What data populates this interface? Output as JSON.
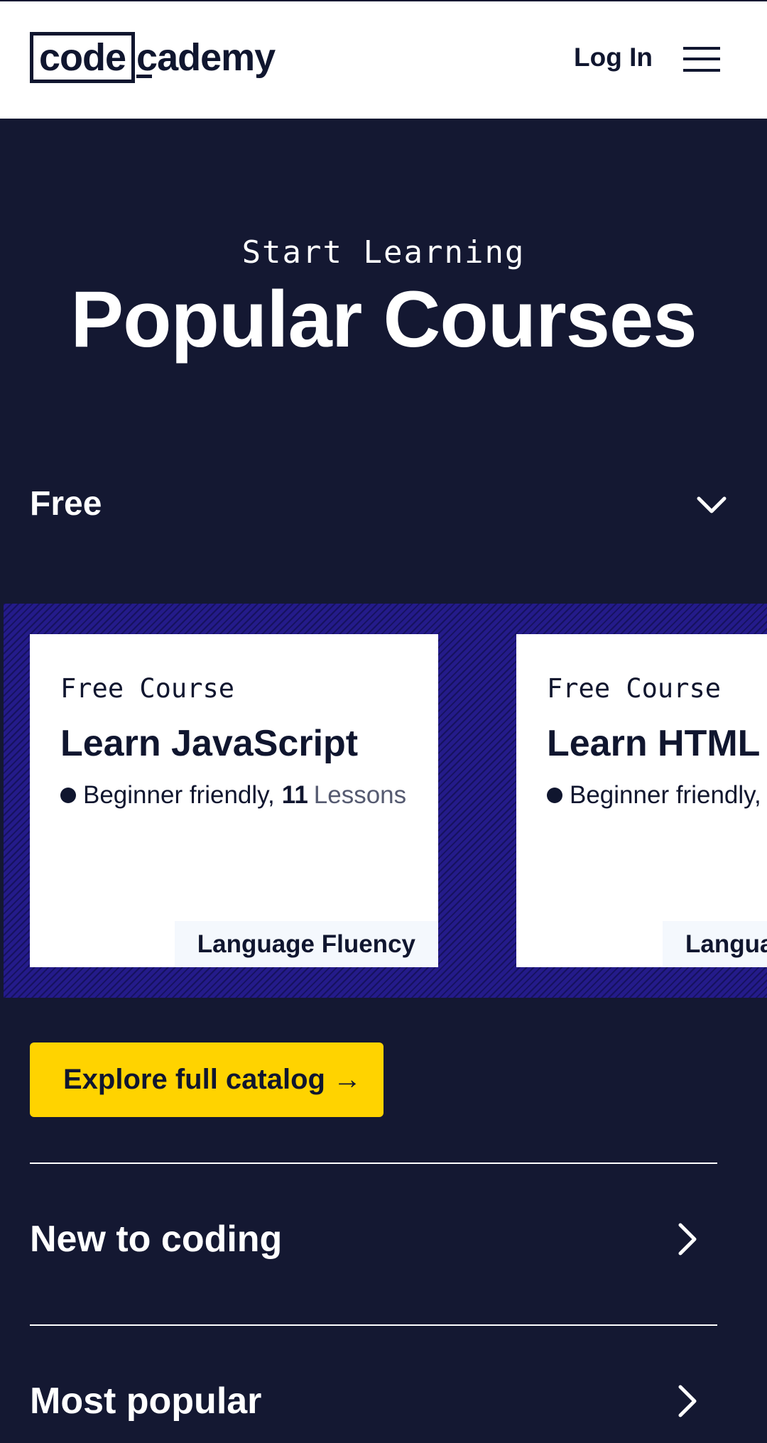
{
  "header": {
    "logo": {
      "boxed": "code",
      "rest": "cademy"
    },
    "login_label": "Log In",
    "menu_icon": "hamburger-menu-icon"
  },
  "hero": {
    "eyebrow": "Start Learning",
    "title": "Popular Courses"
  },
  "filter": {
    "selected": "Free",
    "icon": "chevron-down-icon"
  },
  "courses": [
    {
      "kicker": "Free Course",
      "title": "Learn JavaScript",
      "meta_text": "Beginner friendly,",
      "lessons_count": "11",
      "lessons_unit": "Lessons",
      "tag": "Language Fluency"
    },
    {
      "kicker": "Free Course",
      "title": "Learn HTML",
      "meta_text": "Beginner friendly,",
      "tag": "Language Fluency"
    }
  ],
  "cta": {
    "label": "Explore full catalog →"
  },
  "sections": [
    {
      "label": "New to coding",
      "icon": "chevron-right-icon"
    },
    {
      "label": "Most popular",
      "icon": "chevron-right-icon"
    }
  ],
  "colors": {
    "background": "#141832",
    "accent_yellow": "#ffd300",
    "carousel_bg": "#241b8a",
    "text_dark": "#10162f"
  }
}
